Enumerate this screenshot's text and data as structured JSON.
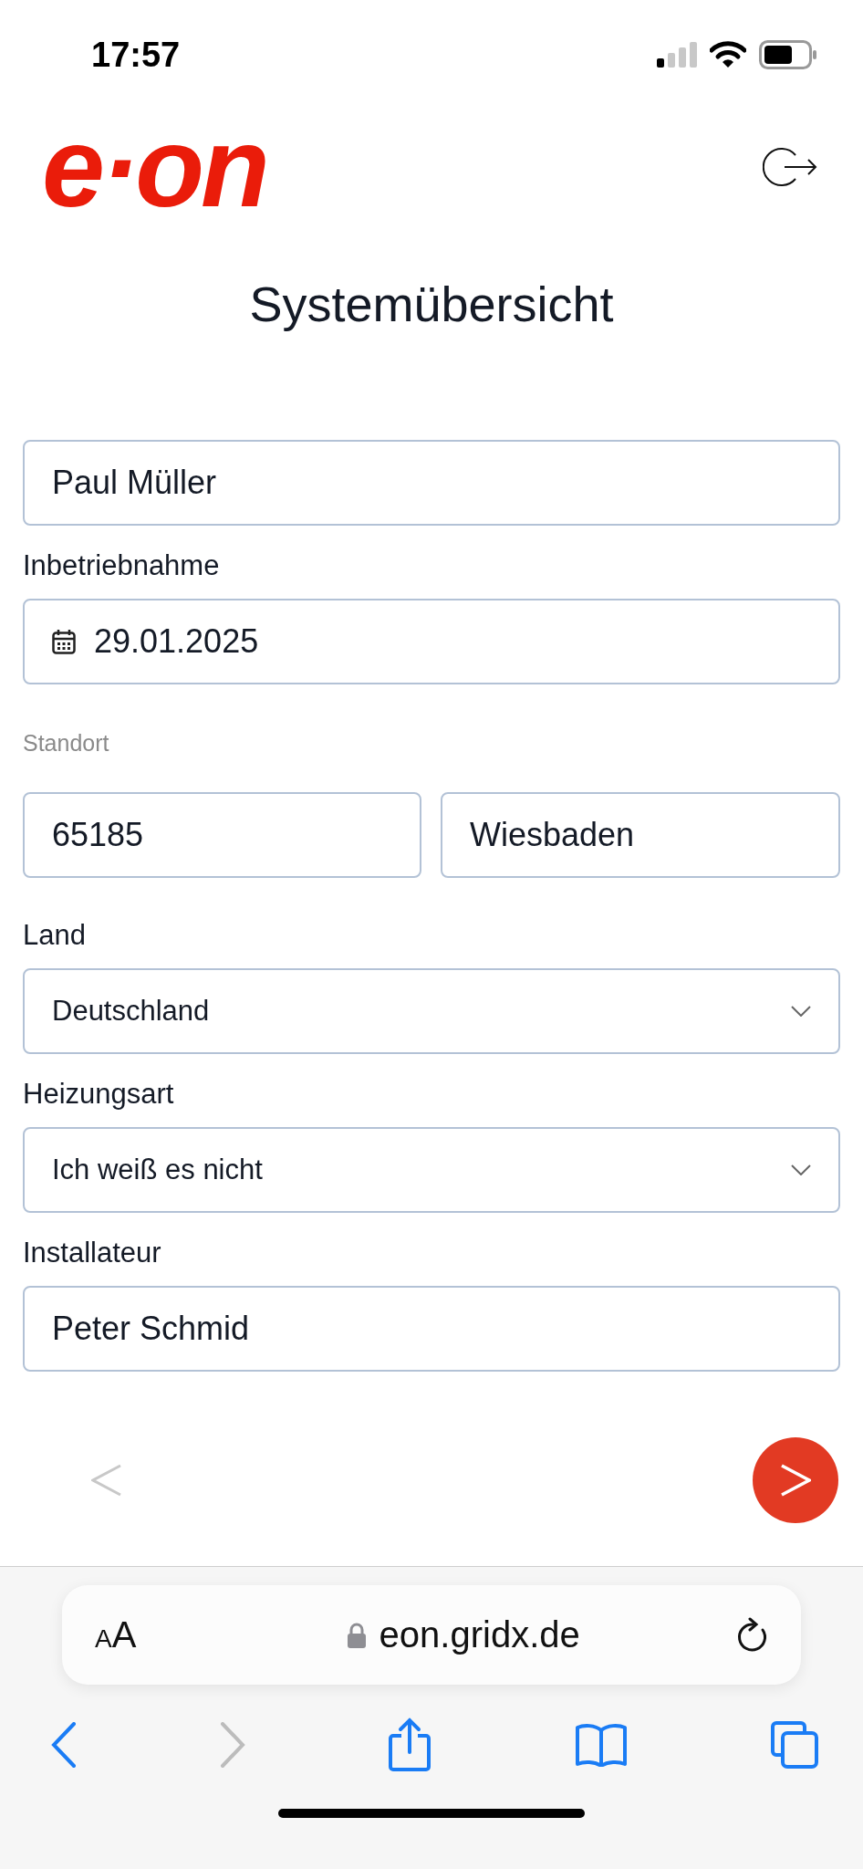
{
  "status_bar": {
    "time": "17:57"
  },
  "header": {
    "logo": "e·on"
  },
  "title": "Systemübersicht",
  "fields": [
    {
      "kind": "text",
      "value": "Paul Müller"
    },
    {
      "kind": "date",
      "label": "Inbetriebnahme",
      "value": "29.01.2025"
    },
    {
      "kind": "pair",
      "label": "Standort",
      "values": [
        "65185",
        "Wiesbaden"
      ]
    },
    {
      "kind": "select",
      "label": "Land",
      "value": "Deutschland"
    },
    {
      "kind": "select",
      "label": "Heizungsart",
      "value": "Ich weiß es nicht"
    },
    {
      "kind": "text",
      "label": "Installateur",
      "value": "Peter Schmid"
    }
  ],
  "pager": {
    "back_disabled": true,
    "next_disabled": false
  },
  "browser": {
    "text_size": "AA",
    "secure": true,
    "url": "eon.gridx.de",
    "back_disabled": false,
    "forward_disabled": true
  }
}
